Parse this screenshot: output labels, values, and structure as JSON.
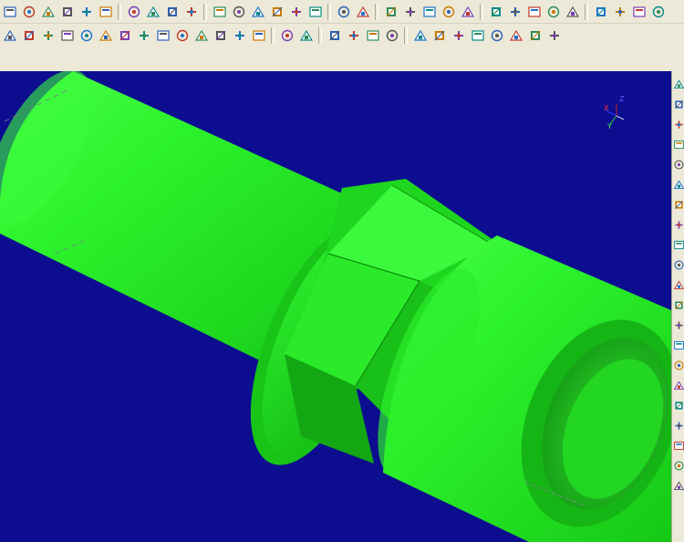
{
  "toolbar_top": {
    "groups": [
      [
        "open-file-icon",
        "save-file-icon",
        "import-icon",
        "export-icon",
        "print-icon",
        "measure-icon"
      ],
      [
        "layer-icon",
        "new-sheet-icon",
        "edit-sheet-icon",
        "sheet-properties-icon"
      ],
      [
        "dimension-icon",
        "tolerance-icon",
        "surface-finish-icon",
        "weld-icon",
        "hatch-icon",
        "pattern-icon"
      ],
      [
        "solid-view-icon",
        "shaded-view-icon"
      ],
      [
        "view-front-icon",
        "view-top-icon",
        "view-side-icon",
        "view-iso-icon",
        "view-options-icon"
      ],
      [
        "rotate-icon",
        "pan-icon",
        "zoom-icon",
        "clip-icon",
        "grid-icon"
      ],
      [
        "distance-icon",
        "zoom-window-icon",
        "zoom-fit-icon",
        "render-icon"
      ]
    ]
  },
  "toolbar_second": {
    "groups": [
      [
        "snap-icon",
        "trim-icon",
        "extend-icon",
        "fillet-icon",
        "chamfer-icon",
        "offset-icon",
        "mirror-icon",
        "move-icon",
        "copy-icon",
        "scale-icon",
        "stretch-icon",
        "break-icon",
        "list-icon",
        "help-icon"
      ],
      [
        "render-mode-icon",
        "sphere-shading-icon"
      ],
      [
        "box-solid-icon",
        "cylinder-solid-icon",
        "cone-solid-icon",
        "wedge-solid-icon"
      ],
      [
        "orbit-icon",
        "zoom-extents-icon",
        "pan-view-icon",
        "view-cube-front-icon",
        "view-cube-back-icon",
        "view-cube-left-icon",
        "view-cube-right-icon",
        "view-cube-top-icon"
      ]
    ]
  },
  "right_toolbar": {
    "items": [
      "add-icon",
      "line-icon",
      "circle-icon",
      "rectangle-icon",
      "arc-icon",
      "polyline-icon",
      "extrude-icon",
      "revolve-icon",
      "sweep-icon",
      "pencil-icon",
      "sketch-icon",
      "edit-icon",
      "constraint-icon",
      "hole-icon",
      "thread-icon",
      "fillet-edge-icon",
      "shell-icon",
      "boolean-icon",
      "split-icon",
      "sum-icon",
      "assembly-icon"
    ]
  },
  "viewport": {
    "background_color": "#0d0d90",
    "model_color": "#22e822",
    "triad_labels": {
      "x": "X",
      "y": "Y",
      "z": "Z"
    }
  }
}
